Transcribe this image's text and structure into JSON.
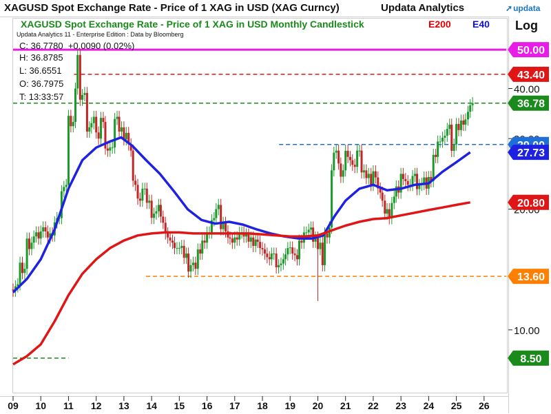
{
  "header": {
    "title": "XAGUSD Spot Exchange Rate - Price of 1 XAG in USD (XAG Curncy)",
    "vendor": "Updata Analytics",
    "logo_text": "updata",
    "logo_icon": "arrow-icon"
  },
  "chart_meta": {
    "chart_title": "XAGUSD Spot Exchange Rate - Price of 1 XAG in USD Monthly Candlestick",
    "edition": "Updata Analytics 11 - Enterprise Edition : Data by Bloomberg",
    "scale_label": "Log",
    "indicator_e200": "E200",
    "indicator_e40": "E40",
    "readout": {
      "close": "C: 36.7780",
      "change": "+0.0090 (0.02%)",
      "high": "H: 36.8785",
      "low": "L: 36.6551",
      "open": "O: 36.7975",
      "time": "T: 13:33:57"
    }
  },
  "colors": {
    "bull": "#1a9a2a",
    "bear": "#c22525",
    "e40": "#1e22e0",
    "e200": "#e01616",
    "magenta": "#e81be8",
    "red_level": "#e01616",
    "green_level": "#1a8a1a",
    "blue_level": "#1f6fd6",
    "orange_level": "#ff7f00"
  },
  "chart_data": {
    "type": "candlestick",
    "title": "XAGUSD Spot Exchange Rate - Price of 1 XAG in USD Monthly Candlestick",
    "yscale": "log",
    "ylim": [
      7.0,
      60.0
    ],
    "x_start": 9.0,
    "x_end": 26.8,
    "x_ticks": [
      "09",
      "10",
      "11",
      "12",
      "13",
      "14",
      "15",
      "16",
      "17",
      "18",
      "19",
      "20",
      "21",
      "22",
      "23",
      "24",
      "25",
      "26"
    ],
    "y_ticks": [
      {
        "value": 10.0,
        "label": "10.00"
      },
      {
        "value": 20.0,
        "label": "20.00"
      },
      {
        "value": 30.0,
        "label": "30.00"
      },
      {
        "value": 40.0,
        "label": "40.00"
      }
    ],
    "price_labels": [
      {
        "value": 50.0,
        "label": "50.00",
        "color": "#e81be8"
      },
      {
        "value": 43.4,
        "label": "43.40",
        "color": "#e01616"
      },
      {
        "value": 36.78,
        "label": "36.78",
        "color": "#1a8a1a"
      },
      {
        "value": 29.0,
        "label": "29.00",
        "color": "#1f6fd6"
      },
      {
        "value": 27.73,
        "label": "27.73",
        "color": "#1e22e0"
      },
      {
        "value": 20.8,
        "label": "20.80",
        "color": "#e01616"
      },
      {
        "value": 13.6,
        "label": "13.60",
        "color": "#ff7f00"
      },
      {
        "value": 8.5,
        "label": "8.50",
        "color": "#1a8a1a"
      }
    ],
    "levels": [
      {
        "value": 50.0,
        "x_from": 9.0,
        "x_to": 26.8,
        "color": "#e81be8",
        "style": "solid"
      },
      {
        "value": 43.4,
        "x_from": 11.2,
        "x_to": 26.8,
        "color": "#e01616",
        "style": "dashed"
      },
      {
        "value": 36.78,
        "x_from": 9.0,
        "x_to": 26.8,
        "color": "#1a8a1a",
        "style": "dashed"
      },
      {
        "value": 29.0,
        "x_from": 18.6,
        "x_to": 26.8,
        "color": "#1f6fd6",
        "style": "dashed"
      },
      {
        "value": 13.6,
        "x_from": 13.8,
        "x_to": 26.8,
        "color": "#ff7f00",
        "style": "dashed"
      },
      {
        "value": 8.5,
        "x_from": 9.0,
        "x_to": 11.0,
        "color": "#1a8a1a",
        "style": "dashed"
      }
    ],
    "close_series": [
      [
        9.0,
        13.0
      ],
      [
        9.25,
        14.2
      ],
      [
        9.5,
        16.5
      ],
      [
        9.75,
        16.9
      ],
      [
        10.0,
        17.6
      ],
      [
        10.25,
        17.2
      ],
      [
        10.5,
        19.0
      ],
      [
        10.75,
        23.0
      ],
      [
        11.0,
        33.0
      ],
      [
        11.25,
        40.0
      ],
      [
        11.33,
        48.5
      ],
      [
        11.42,
        37.5
      ],
      [
        11.5,
        39.0
      ],
      [
        11.67,
        32.0
      ],
      [
        11.83,
        34.0
      ],
      [
        12.0,
        30.0
      ],
      [
        12.17,
        33.0
      ],
      [
        12.33,
        28.0
      ],
      [
        12.5,
        28.5
      ],
      [
        12.67,
        34.0
      ],
      [
        12.83,
        32.0
      ],
      [
        13.0,
        31.0
      ],
      [
        13.17,
        28.0
      ],
      [
        13.33,
        23.0
      ],
      [
        13.5,
        21.0
      ],
      [
        13.67,
        22.5
      ],
      [
        13.83,
        21.0
      ],
      [
        14.0,
        19.5
      ],
      [
        14.17,
        20.5
      ],
      [
        14.33,
        18.5
      ],
      [
        14.5,
        17.0
      ],
      [
        14.67,
        16.5
      ],
      [
        14.83,
        16.0
      ],
      [
        15.0,
        16.2
      ],
      [
        15.17,
        15.5
      ],
      [
        15.33,
        14.5
      ],
      [
        15.5,
        14.2
      ],
      [
        15.67,
        15.5
      ],
      [
        15.83,
        16.5
      ],
      [
        16.0,
        17.5
      ],
      [
        16.17,
        19.0
      ],
      [
        16.33,
        20.5
      ],
      [
        16.5,
        18.5
      ],
      [
        16.67,
        17.0
      ],
      [
        16.83,
        16.5
      ],
      [
        17.0,
        16.8
      ],
      [
        17.17,
        17.5
      ],
      [
        17.33,
        17.3
      ],
      [
        17.5,
        17.0
      ],
      [
        17.67,
        16.8
      ],
      [
        17.83,
        16.0
      ],
      [
        18.0,
        15.5
      ],
      [
        18.17,
        15.0
      ],
      [
        18.33,
        15.5
      ],
      [
        18.5,
        14.5
      ],
      [
        18.67,
        15.0
      ],
      [
        18.83,
        16.0
      ],
      [
        19.0,
        15.5
      ],
      [
        19.17,
        15.0
      ],
      [
        19.33,
        16.5
      ],
      [
        19.5,
        17.5
      ],
      [
        19.67,
        18.0
      ],
      [
        19.83,
        17.0
      ],
      [
        20.0,
        16.5
      ],
      [
        20.17,
        14.5
      ],
      [
        20.25,
        17.0
      ],
      [
        20.42,
        18.0
      ],
      [
        20.5,
        25.0
      ],
      [
        20.58,
        28.0
      ],
      [
        20.75,
        26.0
      ],
      [
        20.83,
        25.0
      ],
      [
        21.0,
        27.0
      ],
      [
        21.17,
        26.5
      ],
      [
        21.25,
        25.5
      ],
      [
        21.42,
        28.0
      ],
      [
        21.58,
        25.0
      ],
      [
        21.75,
        24.5
      ],
      [
        21.92,
        23.0
      ],
      [
        22.0,
        24.0
      ],
      [
        22.17,
        22.0
      ],
      [
        22.33,
        21.0
      ],
      [
        22.42,
        19.5
      ],
      [
        22.5,
        20.0
      ],
      [
        22.58,
        19.0
      ],
      [
        22.67,
        21.5
      ],
      [
        22.83,
        22.0
      ],
      [
        23.0,
        24.5
      ],
      [
        23.08,
        23.5
      ],
      [
        23.25,
        23.0
      ],
      [
        23.42,
        24.5
      ],
      [
        23.58,
        23.0
      ],
      [
        23.75,
        24.0
      ],
      [
        23.92,
        22.5
      ],
      [
        24.0,
        23.5
      ],
      [
        24.17,
        27.0
      ],
      [
        24.33,
        29.5
      ],
      [
        24.5,
        30.5
      ],
      [
        24.67,
        32.5
      ],
      [
        24.83,
        29.0
      ],
      [
        25.0,
        31.5
      ],
      [
        25.17,
        32.5
      ],
      [
        25.33,
        33.5
      ],
      [
        25.42,
        35.0
      ],
      [
        25.5,
        36.78
      ]
    ],
    "series": [
      {
        "name": "E40",
        "color": "#1e22e0",
        "points": [
          [
            9.0,
            12.4
          ],
          [
            9.5,
            13.4
          ],
          [
            10.0,
            15.0
          ],
          [
            10.5,
            17.8
          ],
          [
            11.0,
            22.5
          ],
          [
            11.5,
            26.5
          ],
          [
            12.0,
            28.5
          ],
          [
            12.5,
            29.5
          ],
          [
            12.9,
            30.2
          ],
          [
            13.3,
            28.8
          ],
          [
            13.8,
            26.5
          ],
          [
            14.3,
            24.5
          ],
          [
            14.8,
            22.2
          ],
          [
            15.3,
            20.0
          ],
          [
            15.8,
            18.8
          ],
          [
            16.3,
            18.4
          ],
          [
            16.8,
            18.6
          ],
          [
            17.3,
            18.3
          ],
          [
            17.8,
            17.8
          ],
          [
            18.3,
            17.4
          ],
          [
            18.8,
            17.1
          ],
          [
            19.3,
            16.9
          ],
          [
            19.8,
            16.9
          ],
          [
            20.2,
            17.2
          ],
          [
            20.6,
            19.2
          ],
          [
            21.0,
            21.0
          ],
          [
            21.5,
            22.5
          ],
          [
            22.0,
            23.0
          ],
          [
            22.5,
            22.3
          ],
          [
            23.0,
            22.5
          ],
          [
            23.5,
            23.0
          ],
          [
            24.0,
            23.2
          ],
          [
            24.5,
            24.8
          ],
          [
            25.0,
            26.2
          ],
          [
            25.5,
            27.73
          ]
        ]
      },
      {
        "name": "E200",
        "color": "#e01616",
        "points": [
          [
            9.0,
            8.2
          ],
          [
            9.5,
            8.6
          ],
          [
            10.0,
            9.2
          ],
          [
            10.5,
            10.5
          ],
          [
            11.0,
            12.2
          ],
          [
            11.5,
            13.8
          ],
          [
            12.0,
            15.0
          ],
          [
            12.5,
            16.0
          ],
          [
            13.0,
            16.7
          ],
          [
            13.5,
            17.2
          ],
          [
            14.0,
            17.4
          ],
          [
            14.5,
            17.5
          ],
          [
            15.0,
            17.5
          ],
          [
            15.5,
            17.4
          ],
          [
            16.0,
            17.4
          ],
          [
            16.5,
            17.4
          ],
          [
            17.0,
            17.4
          ],
          [
            17.5,
            17.4
          ],
          [
            18.0,
            17.3
          ],
          [
            18.5,
            17.2
          ],
          [
            19.0,
            17.1
          ],
          [
            19.5,
            17.1
          ],
          [
            20.0,
            17.2
          ],
          [
            20.5,
            17.7
          ],
          [
            21.0,
            18.2
          ],
          [
            21.5,
            18.6
          ],
          [
            22.0,
            18.9
          ],
          [
            22.5,
            19.0
          ],
          [
            23.0,
            19.3
          ],
          [
            23.5,
            19.6
          ],
          [
            24.0,
            19.9
          ],
          [
            24.5,
            20.2
          ],
          [
            25.0,
            20.5
          ],
          [
            25.5,
            20.8
          ]
        ]
      }
    ]
  }
}
